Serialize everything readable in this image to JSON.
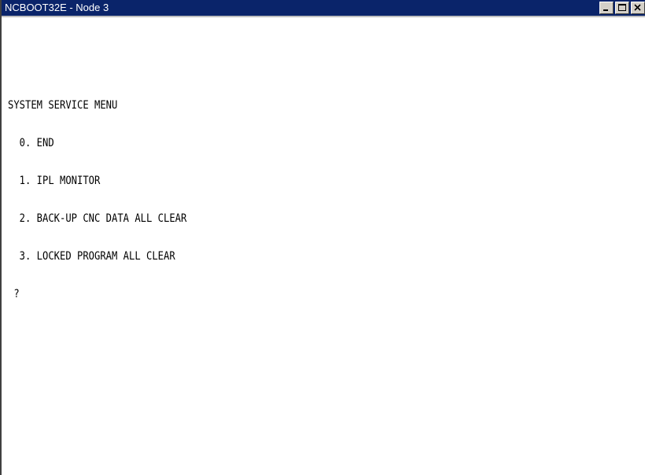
{
  "window": {
    "title": "NCBOOT32E - Node 3",
    "controls": [
      "minimize-icon",
      "maximize-icon",
      "close-icon"
    ]
  },
  "terminal": {
    "lines": [
      "SYSTEM SERVICE MENU",
      "  0. END",
      "  1. IPL MONITOR",
      "  2. BACK-UP CNC DATA ALL CLEAR",
      "  3. LOCKED PROGRAM ALL CLEAR",
      " ?"
    ]
  }
}
